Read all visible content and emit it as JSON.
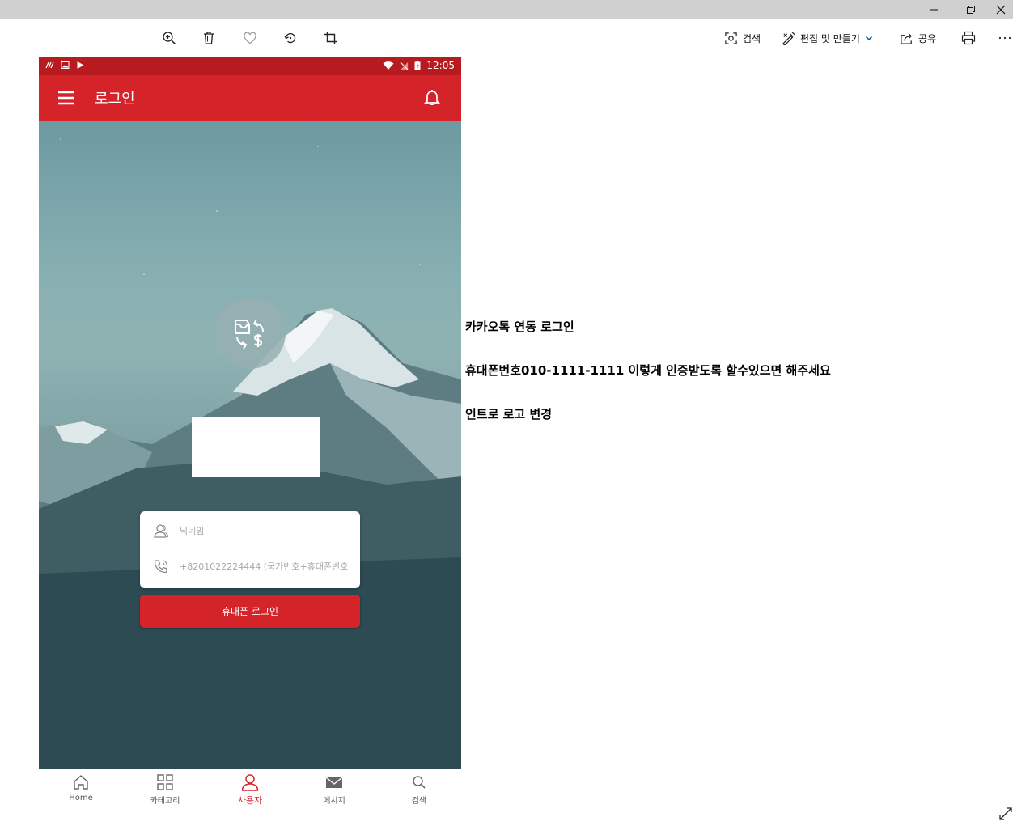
{
  "window": {
    "controls": [
      "minimize-icon",
      "restore-icon",
      "close-icon"
    ]
  },
  "toolbar": {
    "icons": [
      "zoom-in-icon",
      "delete-icon",
      "favorite-icon",
      "rotate-icon",
      "crop-icon"
    ],
    "search_label": "검색",
    "edit_label": "편집 및 만들기",
    "share_label": "공유",
    "print_icon": "print-icon",
    "more_icon": "more-icon"
  },
  "phone": {
    "status": {
      "time": "12:05"
    },
    "appbar": {
      "title": "로그인"
    },
    "form": {
      "nickname_placeholder": "닉네임",
      "phone_placeholder": "+8201022224444 (국가번호+휴대폰번호)",
      "login_button": "휴대폰 로그인"
    },
    "nav": [
      {
        "label": "Home",
        "icon": "home-icon"
      },
      {
        "label": "카테고리",
        "icon": "grid-icon"
      },
      {
        "label": "사용자",
        "icon": "user-icon",
        "active": true
      },
      {
        "label": "메시지",
        "icon": "mail-icon"
      },
      {
        "label": "검색",
        "icon": "search-icon"
      }
    ],
    "colors": {
      "primary": "#d5232a",
      "status_bar": "#b71b1f"
    }
  },
  "notes": [
    "카카오톡 연동 로그인",
    "휴대폰번호010-1111-1111 이렇게 인증받도록 할수있으면 해주세요",
    "인트로 로고 변경"
  ]
}
